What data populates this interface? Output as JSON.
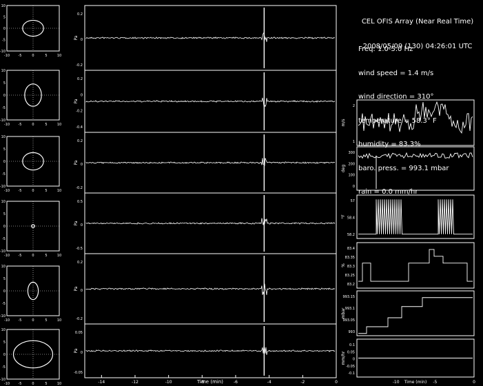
{
  "header": {
    "title": "CEL OFIS Array (Near Real Time)",
    "datetime": "2008/05/09 (130) 04:26:01 UTC"
  },
  "conditions": {
    "freq": "Freq: 1.0-5.0 Hz",
    "wind_speed": "wind speed = 1.4 m/s",
    "wind_direction": "wind direction = 310°",
    "temperature": "temperature = 58.3° F",
    "humidity": "humidity = 83.3%",
    "baro_press": "baro. press. = 993.1 mbar",
    "rain": "rain = 0.0 mm/hr"
  },
  "colors": {
    "background": "#000000",
    "foreground": "#ffffff"
  },
  "chart_data": [
    {
      "type": "scatter",
      "panel": "particle-motion",
      "count": 6,
      "xlim": [
        -10,
        10
      ],
      "ylim": [
        -10,
        10
      ],
      "ticks": [
        "-10",
        "-5",
        "0",
        "5",
        "10"
      ],
      "ellipses": [
        {
          "rx": 4.0,
          "ry": 3.5
        },
        {
          "rx": 3.2,
          "ry": 4.5
        },
        {
          "rx": 4.0,
          "ry": 3.5
        },
        {
          "rx": 0.6,
          "ry": 0.6
        },
        {
          "rx": 2.0,
          "ry": 3.5
        },
        {
          "rx": 7.5,
          "ry": 5.5
        }
      ]
    },
    {
      "type": "line",
      "panel": "waveforms",
      "xlabel": "Time (min)",
      "xlim": [
        -15,
        0
      ],
      "xticks": [
        "-14",
        "-12",
        "-10",
        "-8",
        "-6",
        "-4",
        "-2",
        "0"
      ],
      "event_time": -4.3,
      "ylabel": "Pa",
      "traces": [
        {
          "yticks": [
            "0.2",
            "0",
            "-0.2"
          ]
        },
        {
          "yticks": [
            "0.2",
            "0",
            "-0.2",
            "-0.4"
          ]
        },
        {
          "yticks": [
            "0.2",
            "0",
            "-0.2"
          ]
        },
        {
          "yticks": [
            "0.5",
            "0",
            "-0.5"
          ]
        },
        {
          "yticks": [
            "0.2",
            "0",
            "-0.2"
          ]
        },
        {
          "yticks": [
            "0.05",
            "0",
            "-0.05"
          ]
        }
      ]
    },
    {
      "type": "line",
      "panel": "met",
      "xlabel": "Time (min)",
      "xlim": [
        -15,
        0
      ],
      "xticks": [
        "-10",
        "-5",
        "0"
      ],
      "series": [
        {
          "name": "m/s",
          "yticks": [
            "2",
            "1"
          ]
        },
        {
          "name": "deg",
          "yticks": [
            "300",
            "200",
            "100",
            "0"
          ]
        },
        {
          "name": "°F",
          "yticks": [
            "57",
            "58.4",
            "58.2"
          ]
        },
        {
          "name": "%",
          "yticks": [
            "83.4",
            "83.35",
            "83.3",
            "83.25",
            "83.2"
          ]
        },
        {
          "name": "mbar",
          "yticks": [
            "993.15",
            "993.1",
            "993.05",
            "993"
          ]
        },
        {
          "name": "mm/hr",
          "yticks": [
            "0.1",
            "0.05",
            "0",
            "-0.05",
            "-0.1"
          ]
        }
      ]
    }
  ]
}
